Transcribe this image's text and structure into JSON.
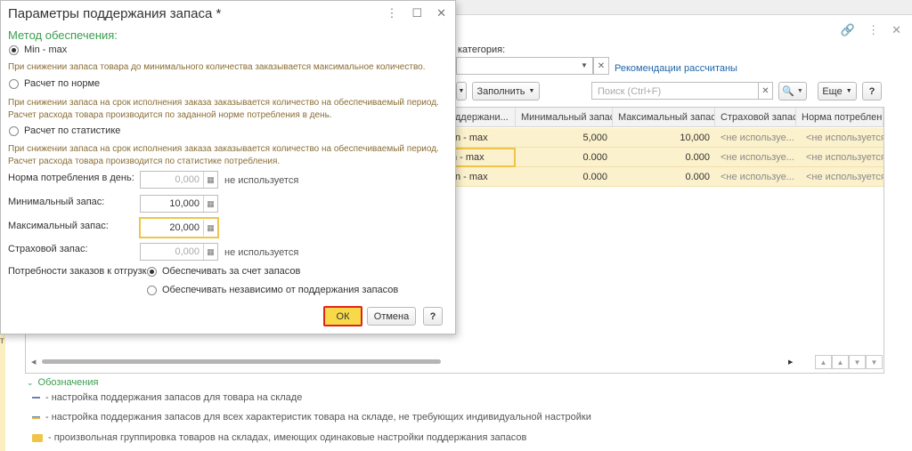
{
  "modal": {
    "title": "Параметры поддержания запаса *",
    "section": "Метод обеспечения:",
    "options": [
      {
        "label": "Min - max",
        "desc": "При снижении запаса товара до минимального количества заказывается максимальное количество."
      },
      {
        "label": "Расчет по норме",
        "desc": "При снижении запаса на срок исполнения заказа заказывается количество на обеспечиваемый период. Расчет расхода товара производится по заданной норме потребления в день."
      },
      {
        "label": "Расчет по статистике",
        "desc": "При снижении запаса на срок исполнения заказа заказывается количество на обеспечиваемый период. Расчет расхода товара производится по статистике потребления."
      }
    ],
    "fields": {
      "norm_label": "Норма потребления в день:",
      "norm_value": "0,000",
      "norm_note": "не используется",
      "min_label": "Минимальный запас:",
      "min_value": "10,000",
      "max_label": "Максимальный запас:",
      "max_value": "20,000",
      "safety_label": "Страховой запас:",
      "safety_value": "0,000",
      "safety_note": "не используется"
    },
    "needs_label": "Потребности заказов к отгрузке:",
    "needs_options": [
      "Обеспечивать за счет запасов",
      "Обеспечивать независимо от поддержания запасов"
    ],
    "ok": "ОК",
    "cancel": "Отмена",
    "help": "?"
  },
  "background": {
    "category_label": "категория:",
    "recommendations_link": "Рекомендации рассчитаны",
    "fill_button": "Заполнить",
    "search_placeholder": "Поиск (Ctrl+F)",
    "more_button": "Еще",
    "help": "?",
    "columns": [
      "оддержани...",
      "Минимальный запас",
      "Максимальный запас",
      "Страховой запас",
      "Норма потребления"
    ],
    "rows": [
      [
        "n - max",
        "5,000",
        "10,000",
        "<не используе...",
        "<не используется>"
      ],
      [
        "n - max",
        "0.000",
        "0.000",
        "<не используе...",
        "<не используется>"
      ],
      [
        "n - max",
        "0.000",
        "0.000",
        "<не используе...",
        "<не используется>"
      ]
    ],
    "left_char": "т",
    "legend_title": "Обозначения",
    "legend": [
      "- настройка поддержания запасов для товара на складе",
      "- настройка поддержания запасов для всех характеристик товара на складе, не требующих индивидуальной настройки",
      "- произвольная группировка товаров на складах, имеющих одинаковые настройки поддержания запасов"
    ]
  }
}
